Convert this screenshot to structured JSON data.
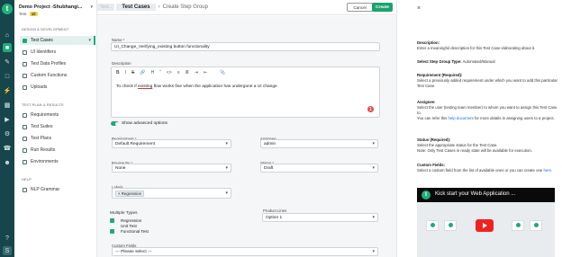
{
  "project": {
    "name": "Demo Project -Shubhangi...",
    "version_label": "Test",
    "version_badge": "10"
  },
  "nav": {
    "design_section": "DESIGN & DEVELOPMENT",
    "design_items": [
      "Test Cases",
      "UI Identifiers",
      "Test Data Profiles",
      "Custom Functions",
      "Uploads"
    ],
    "plan_section": "TEST PLAN & RESULTS",
    "plan_items": [
      "Requirements",
      "Test Suites",
      "Test Plans",
      "Run Results",
      "Environments"
    ],
    "help_section": "HELP",
    "help_items": [
      "NLP Grammar"
    ]
  },
  "header": {
    "crumb_faded": "Test...",
    "crumb_active": "Test Cases",
    "crumb_current": "Create Step Group",
    "cancel_label": "Cancel",
    "create_label": "Create"
  },
  "form": {
    "name_label": "Name",
    "name_value": "UI_Change_Verifying_existing button functionality",
    "desc_label": "Description",
    "desc_text_prefix": "To check if ",
    "desc_text_underlined": "existing",
    "desc_text_suffix": " flow works fine when the application has undergone a UI change",
    "grammar_count": "1",
    "advanced_label": "Show advanced options",
    "requirement_label": "Requirement",
    "requirement_value": "Default Requirement",
    "assignee_label": "Assignee",
    "assignee_value": "admin",
    "reviewby_label": "Review By",
    "reviewby_value": "None",
    "status_label": "Status",
    "status_value": "Draft",
    "labels_label": "Labels",
    "labels_chip": "Regression",
    "multiple_types_label": "Multiple Types",
    "types": [
      "Regression",
      "Unit Test",
      "Functional Test"
    ],
    "product_lines_label": "Product Lines",
    "product_lines_value": "Option 1",
    "custom_fields_label": "Custom Fields",
    "custom_fields_value": "--- Please select ---"
  },
  "help": {
    "description_title": "Description:",
    "description_text": "Enter a meaningful description for this Test Case elaborating about it.",
    "stepgroup_title": "Select Step Group Type:",
    "stepgroup_text": "Automated/Manual",
    "requirement_title": "Requirement (Required):",
    "requirement_text": "Select a previously added requirement under which you want to add this particular Test Case.",
    "assignee_title": "Assignee:",
    "assignee_text1": "Select the user (testing team member) to whom you want to assign this Test Case to.",
    "assignee_text2_prefix": "You can refer this ",
    "assignee_link": "help document",
    "assignee_text2_suffix": " for more details in assigning users to a project.",
    "status_title": "Status (Required):",
    "status_text1": "Select the appropriate status for the Test Case.",
    "status_text2": "Note: Only Test Cases in ready state will be available for execution.",
    "custom_title": "Custom Fields:",
    "custom_text_prefix": "Select a custom field from the list of available ones or you can create one ",
    "custom_link": "here",
    "custom_text_suffix": ".",
    "video_title": "Kick start your Web Application ..."
  },
  "colors": {
    "accent": "#1aa36f",
    "rail": "#16464b",
    "danger": "#e24d4d"
  }
}
